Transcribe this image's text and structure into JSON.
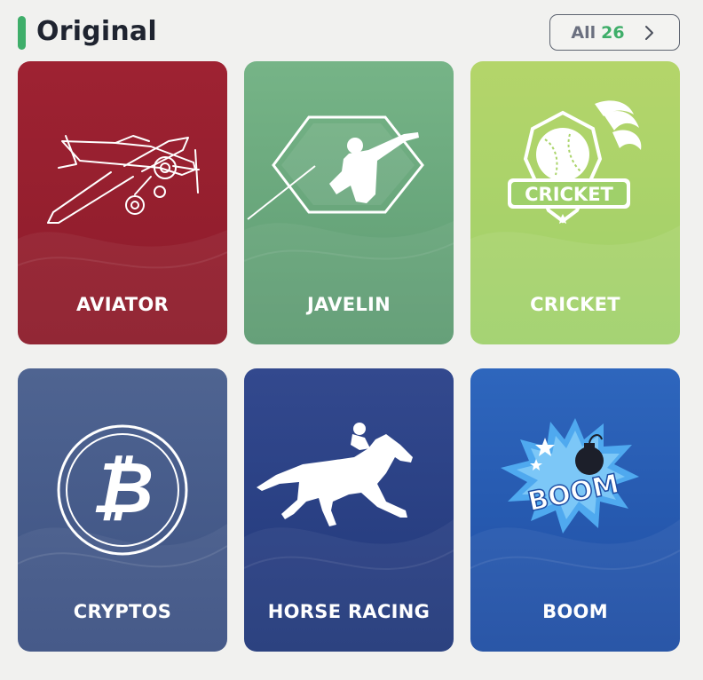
{
  "section": {
    "title": "Original",
    "accent_color": "#3fae6a",
    "all_label": "All",
    "all_count": "26",
    "chevron_icon": "chevron-right-icon"
  },
  "games": [
    {
      "name": "AVIATOR",
      "icon": "airplane-icon",
      "color": "#9e2232"
    },
    {
      "name": "JAVELIN",
      "icon": "javelin-thrower-icon",
      "color": "#6aa97c"
    },
    {
      "name": "CRICKET",
      "icon": "cricket-ball-badge-icon",
      "color": "#aad46a"
    },
    {
      "name": "CRYPTOS",
      "icon": "bitcoin-icon",
      "color": "#475c8c"
    },
    {
      "name": "HORSE RACING",
      "icon": "horse-jockey-icon",
      "color": "#2a4185"
    },
    {
      "name": "BOOM",
      "icon": "bomb-explosion-icon",
      "color": "#2859b0"
    }
  ],
  "badge_texts": {
    "cricket": "CRICKET",
    "boom": "BOOM"
  }
}
